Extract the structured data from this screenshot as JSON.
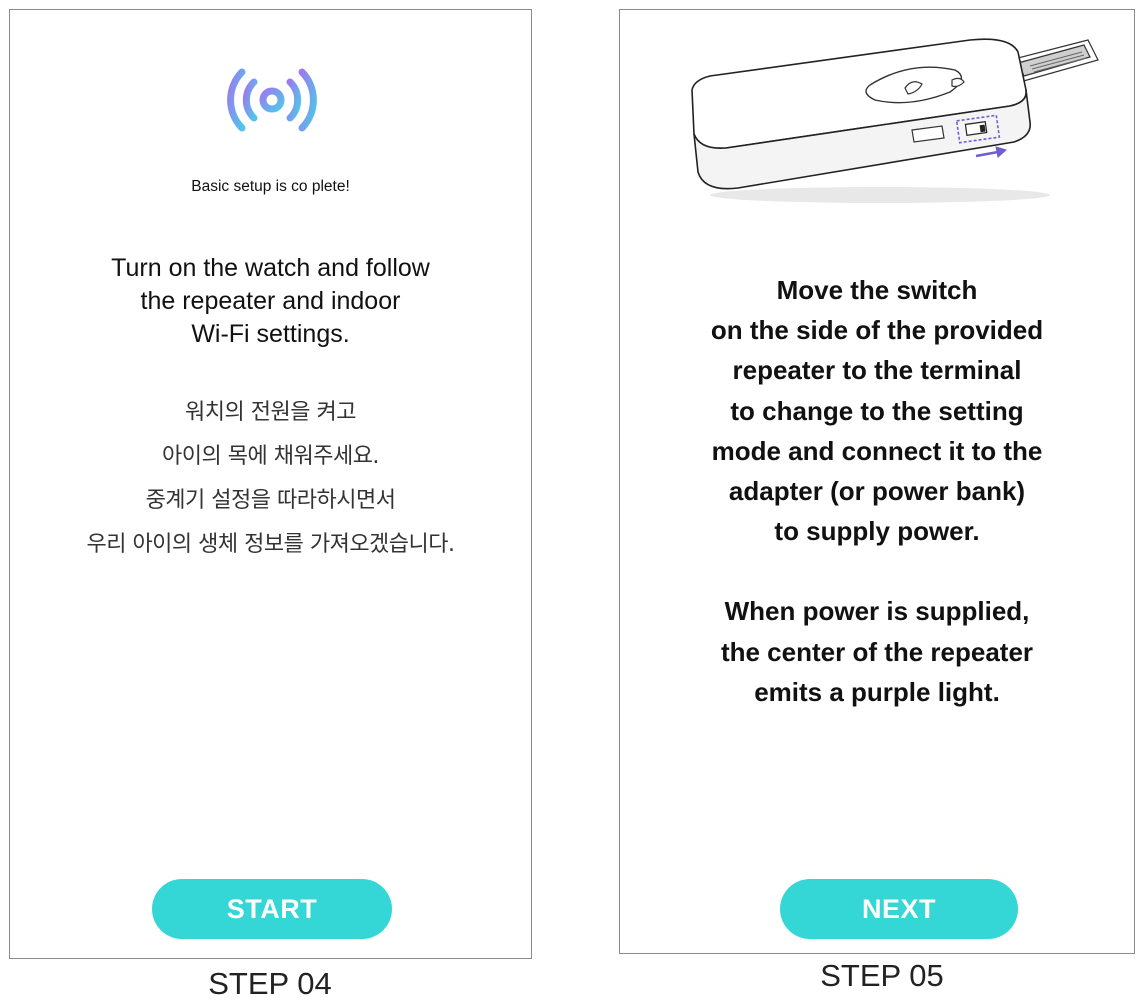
{
  "step04": {
    "setup_complete": "Basic setup is co plete!",
    "instruction_en": [
      "Turn on the watch and follow",
      "the repeater and indoor",
      "Wi-Fi settings."
    ],
    "instruction_ko": [
      "워치의 전원을 켜고",
      "아이의 목에 채워주세요.",
      "중계기 설정을 따라하시면서",
      "우리 아이의 생체 정보를 가져오겠습니다."
    ],
    "button_label": "START",
    "caption": "STEP 04",
    "icon": "wifi-broadcast-icon"
  },
  "step05": {
    "instructions": [
      "Move the switch",
      "on the side of the provided",
      "repeater to the terminal",
      "to change to the setting",
      "mode and connect it to the",
      "adapter (or power bank)",
      "to supply power."
    ],
    "power_note": [
      "When power is supplied,",
      "the center of the repeater",
      "emits a purple light."
    ],
    "button_label": "NEXT",
    "caption": "STEP 05",
    "icon": "repeater-device-illustration"
  },
  "colors": {
    "button": "#35d7d6",
    "button_text": "#ffffff",
    "icon_gradient_start": "#8f7bf0",
    "icon_gradient_end": "#4fc3e8",
    "arrow": "#6b5fd3"
  }
}
